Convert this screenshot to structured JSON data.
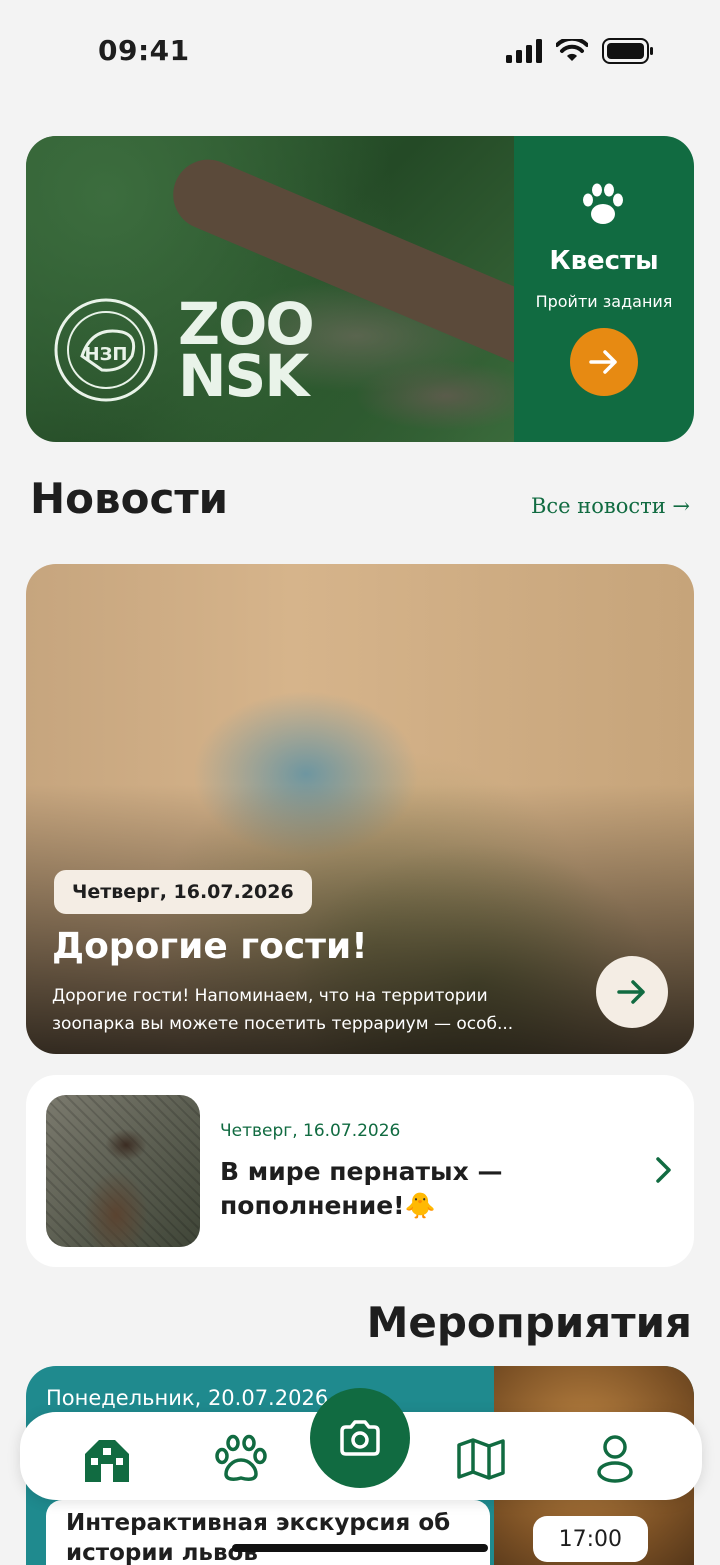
{
  "status_bar": {
    "time": "09:41"
  },
  "hero": {
    "logo_text_line1": "ZOO",
    "logo_text_line2": "NSK",
    "quest_title": "Квесты",
    "quest_subtitle": "Пройти задания"
  },
  "news": {
    "section_title": "Новости",
    "all_news_link": "Все новости →",
    "featured": {
      "date": "Четверг, 16.07.2026",
      "title": "Дорогие гости!",
      "excerpt": "Дорогие гости! Напоминаем, что на территории зоопарка вы можете посетить террариум — особ..."
    },
    "items": [
      {
        "date": "Четверг, 16.07.2026",
        "title": "В мире пернатых — пополнение!🐥"
      }
    ]
  },
  "events": {
    "section_title": "Мероприятия",
    "items": [
      {
        "date": "Понедельник, 20.07.2026",
        "title": "Интерактивная экскурсия об истории львов",
        "time": "17:00"
      }
    ]
  },
  "colors": {
    "brand_green": "#116b41",
    "accent_orange": "#e78a12",
    "teal": "#1f8a8e"
  },
  "icons": [
    "signal-icon",
    "wifi-icon",
    "battery-icon",
    "paw-icon",
    "arrow-right-icon",
    "chevron-right-icon",
    "home-icon",
    "camera-icon",
    "map-icon",
    "profile-icon"
  ]
}
